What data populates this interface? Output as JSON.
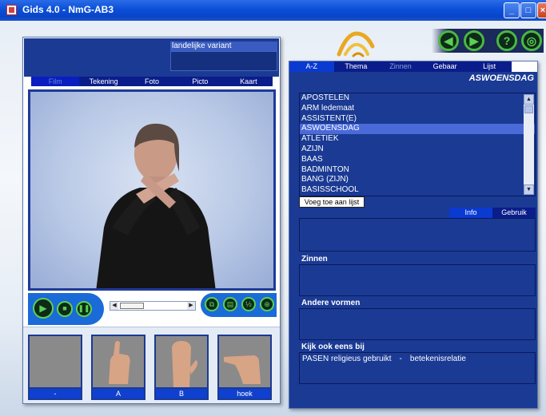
{
  "window": {
    "title": "Gids 4.0 - NmG-AB3"
  },
  "left": {
    "variant_label": "landelijke variant",
    "media_tabs": [
      "Film",
      "Tekening",
      "Foto",
      "Picto",
      "Kaart"
    ],
    "active_media_tab": "Film",
    "handshapes": [
      {
        "label": "-"
      },
      {
        "label": "A"
      },
      {
        "label": "B"
      },
      {
        "label": "hoek"
      }
    ]
  },
  "right": {
    "tabs": [
      "A-Z",
      "Thema",
      "Zinnen",
      "Gebaar",
      "Lijst"
    ],
    "active_tab": "A-Z",
    "current_word": "ASWOENSDAG",
    "word_list": [
      "APOSTELEN",
      "ARM ledemaat",
      "ASSISTENT(E)",
      "ASWOENSDAG",
      "ATLETIEK",
      "AZIJN",
      "BAAS",
      "BADMINTON",
      "BANG (ZIJN)",
      "BASISSCHOOL"
    ],
    "selected_word": "ASWOENSDAG",
    "add_button": "Voeg toe aan lijst",
    "info_tabs": [
      "Info",
      "Gebruik"
    ],
    "sections": {
      "zinnen": "Zinnen",
      "andere_vormen": "Andere vormen",
      "kijk_ook": "Kijk ook eens bij"
    },
    "see_also": {
      "word": "PASEN religieus gebruikt",
      "separator": "-",
      "relation": "betekenisrelatie"
    }
  },
  "colors": {
    "panel_blue": "#1a3a94",
    "tab_bar": "#0a1d8a",
    "selection": "#4a6ad8",
    "control_green": "#5ad050"
  }
}
